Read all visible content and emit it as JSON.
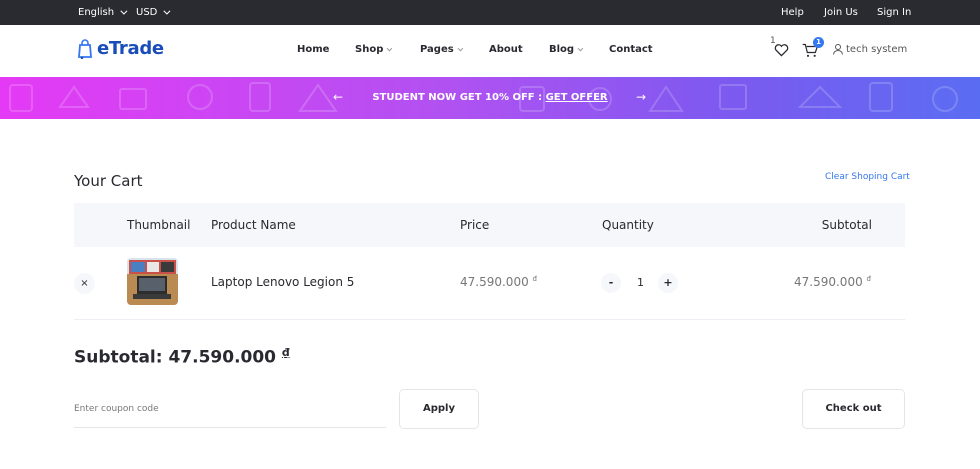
{
  "topbar": {
    "language": "English",
    "currency": "USD",
    "help": "Help",
    "join": "Join Us",
    "signin": "Sign In"
  },
  "header": {
    "brand": "eTrade",
    "nav": [
      "Home",
      "Shop",
      "Pages",
      "About",
      "Blog",
      "Contact"
    ],
    "wishlist_count": "1",
    "cart_count": "1",
    "user_name": "tech system"
  },
  "promo": {
    "text": "STUDENT NOW GET 10% OFF : ",
    "link": "GET OFFER",
    "prev_arrow": "←",
    "next_arrow": "→"
  },
  "cart": {
    "title": "Your Cart",
    "clear_label": "Clear Shoping Cart",
    "columns": [
      "Thumbnail",
      "Product Name",
      "Price",
      "Quantity",
      "Subtotal"
    ],
    "items": [
      {
        "remove": "×",
        "name": "Laptop Lenovo Legion 5",
        "price": "47.590.000",
        "currency": "đ",
        "minus": "-",
        "quantity": "1",
        "plus": "+",
        "subtotal": "47.590.000"
      }
    ],
    "subtotal_label": "Subtotal: 47.590.000",
    "subtotal_currency": "₫",
    "coupon_placeholder": "Enter coupon code",
    "apply_label": "Apply",
    "checkout_label": "Check out"
  },
  "colors": {
    "accent": "#3577f0",
    "brand": "#1b4db8",
    "topbar_bg": "#2a2b31",
    "promo_gradient_start": "#e53af5",
    "promo_gradient_end": "#5a6df2"
  }
}
